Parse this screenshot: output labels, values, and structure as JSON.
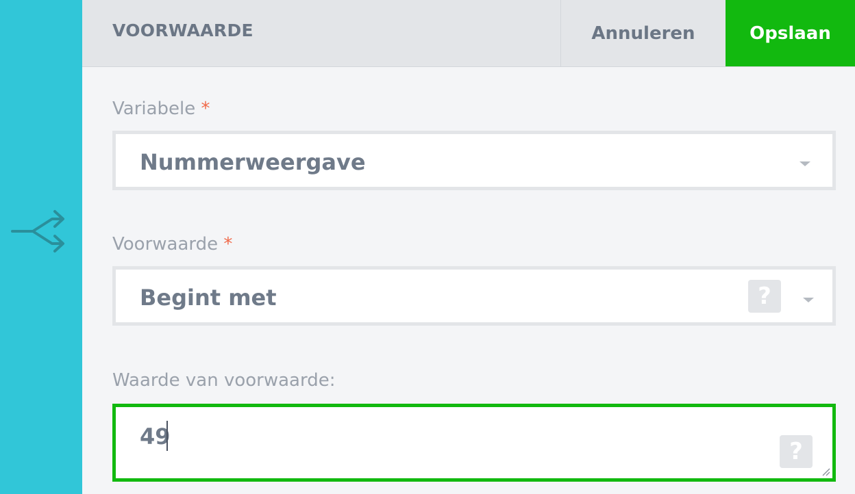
{
  "header": {
    "title": "VOORWAARDE",
    "cancel_label": "Annuleren",
    "save_label": "Opslaan"
  },
  "form": {
    "variable": {
      "label": "Variabele",
      "required_mark": "*",
      "value": "Nummerweergave"
    },
    "condition": {
      "label": "Voorwaarde",
      "required_mark": "*",
      "value": "Begint met",
      "help_icon": "?"
    },
    "condition_value": {
      "label": "Waarde van voorwaarde:",
      "value": "49",
      "help_icon": "?"
    }
  },
  "icons": {
    "rail_icon": "branch-split-icon",
    "dropdown_icon": "caret-down-icon",
    "help_icon": "question-mark-icon"
  },
  "colors": {
    "rail": "#31c6d8",
    "save_button": "#12b90f",
    "required": "#f06a4a",
    "focus_border": "#12b90f"
  }
}
